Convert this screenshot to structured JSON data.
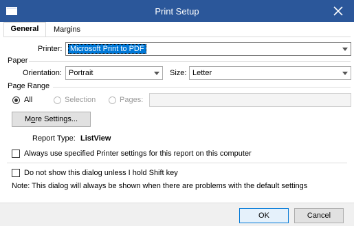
{
  "window": {
    "title": "Print Setup"
  },
  "tabs": [
    {
      "label": "General",
      "active": true
    },
    {
      "label": "Margins",
      "active": false
    }
  ],
  "printer": {
    "label": "Printer:",
    "value": "Microsoft Print to PDF"
  },
  "paper": {
    "section_label": "Paper",
    "orientation_label": "Orientation:",
    "orientation_value": "Portrait",
    "size_label": "Size:",
    "size_value": "Letter"
  },
  "page_range": {
    "section_label": "Page Range",
    "all_label": "All",
    "selection_label": "Selection",
    "pages_label": "Pages:",
    "selected": "All"
  },
  "more_settings": {
    "label_prefix": "M",
    "label_u": "o",
    "label_suffix": "re Settings..."
  },
  "report": {
    "type_label": "Report Type:",
    "type_value": "ListView"
  },
  "options": {
    "always_use_label": "Always use specified Printer settings for this report on this computer",
    "always_use_checked": false,
    "do_not_show_label": "Do not show this dialog unless I hold Shift key",
    "do_not_show_checked": false,
    "note": "Note: This dialog will always be shown when there are problems with the default settings"
  },
  "buttons": {
    "ok": "OK",
    "cancel": "Cancel"
  },
  "colors": {
    "titlebar": "#2b579a",
    "accent": "#0078d7"
  },
  "icons": {
    "app": "window-icon",
    "close": "close-icon"
  }
}
